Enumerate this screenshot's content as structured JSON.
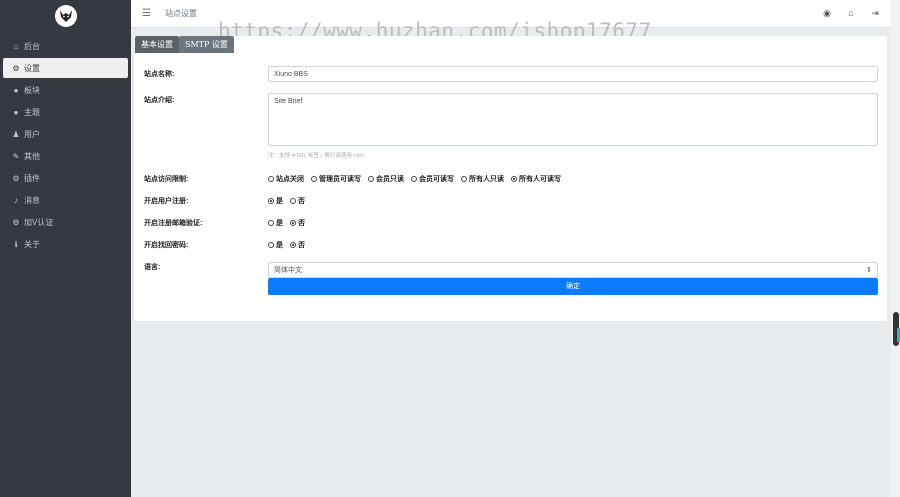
{
  "sidebar": {
    "logo_icon": "wolf-logo-icon",
    "items": [
      {
        "label": "后台",
        "icon": "home-icon",
        "glyph": "⌂",
        "active": false
      },
      {
        "label": "设置",
        "icon": "gear-icon",
        "glyph": "⚙",
        "active": true
      },
      {
        "label": "板块",
        "icon": "comment-icon",
        "glyph": "●",
        "active": false
      },
      {
        "label": "主题",
        "icon": "comment-icon",
        "glyph": "●",
        "active": false
      },
      {
        "label": "用户",
        "icon": "user-icon",
        "glyph": "♟",
        "active": false
      },
      {
        "label": "其他",
        "icon": "wrench-icon",
        "glyph": "✎",
        "active": false
      },
      {
        "label": "插件",
        "icon": "cogs-icon",
        "glyph": "⚙",
        "active": false
      },
      {
        "label": "消息",
        "icon": "bell-icon",
        "glyph": "♪",
        "active": false
      },
      {
        "label": "加V认证",
        "icon": "cogs-icon",
        "glyph": "⚙",
        "active": false
      },
      {
        "label": "关于",
        "icon": "info-icon",
        "glyph": "ℹ",
        "active": false
      }
    ]
  },
  "topbar": {
    "menu_glyph": "☰",
    "title": "站点设置",
    "watermark": "https://www.huzhan.com/ishop17677",
    "icons": [
      {
        "name": "avatar-icon",
        "glyph": "◉"
      },
      {
        "name": "home-icon",
        "glyph": "⌂"
      },
      {
        "name": "logout-icon",
        "glyph": "⇥"
      }
    ]
  },
  "tabs": [
    {
      "label": "基本设置",
      "active": true
    },
    {
      "label": "SMTP 设置",
      "active": false
    }
  ],
  "form": {
    "site_name": {
      "label": "站点名称:",
      "value": "Xiuno BBS"
    },
    "site_brief": {
      "label": "站点介绍:",
      "value": "Site Brief",
      "hint": "注：支持 HTML 标签，换行请使用 <br>"
    },
    "access": {
      "label": "站点访问限制:",
      "options": [
        "站点关闭",
        "管理员可读写",
        "会员只读",
        "会员可读写",
        "所有人只读",
        "所有人可读写"
      ],
      "selected": 5
    },
    "user_register": {
      "label": "开启用户注册:",
      "options": [
        "是",
        "否"
      ],
      "selected": 0
    },
    "email_verify": {
      "label": "开启注册邮箱验证:",
      "options": [
        "是",
        "否"
      ],
      "selected": 1
    },
    "find_password": {
      "label": "开启找回密码:",
      "options": [
        "是",
        "否"
      ],
      "selected": 1
    },
    "language": {
      "label": "语言:",
      "value": "简体中文",
      "arrow": "⇕"
    },
    "submit_label": "确定"
  },
  "colors": {
    "sidebar_bg": "#343a40",
    "accent": "#0d7bfd",
    "tab_bg": "#6c757d"
  }
}
